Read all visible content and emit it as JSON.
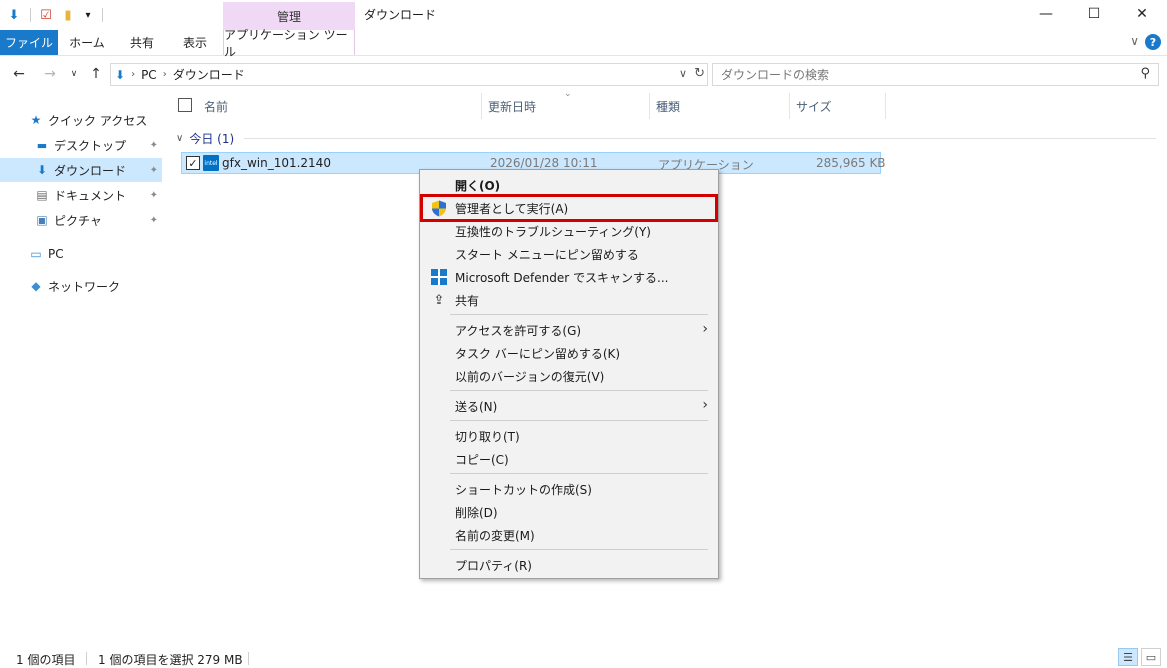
{
  "window": {
    "title": "ダウンロード",
    "manage_tab": "管理",
    "minimize": "—",
    "maximize": "☐",
    "close": "✕"
  },
  "ribbon": {
    "tabs": [
      {
        "label": "ファイル"
      },
      {
        "label": "ホーム"
      },
      {
        "label": "共有"
      },
      {
        "label": "表示"
      },
      {
        "label": "アプリケーション ツール"
      }
    ],
    "expand_glyph": "∨",
    "help_glyph": "?"
  },
  "address": {
    "crumbs": [
      "PC",
      "ダウンロード"
    ],
    "sep": "›",
    "search_placeholder": "ダウンロードの検索"
  },
  "sidebar": {
    "items": [
      {
        "label": "クイック アクセス",
        "icon": "star-icon"
      },
      {
        "label": "デスクトップ",
        "icon": "desktop-icon"
      },
      {
        "label": "ダウンロード",
        "icon": "download-icon"
      },
      {
        "label": "ドキュメント",
        "icon": "document-icon"
      },
      {
        "label": "ピクチャ",
        "icon": "picture-icon"
      },
      {
        "label": "PC",
        "icon": "pc-icon"
      },
      {
        "label": "ネットワーク",
        "icon": "network-icon"
      }
    ]
  },
  "columns": {
    "name": "名前",
    "date": "更新日時",
    "type": "種類",
    "size": "サイズ"
  },
  "group": {
    "label": "今日 (1)"
  },
  "file": {
    "name": "gfx_win_101.2140",
    "date": "2026/01/28 10:11",
    "type": "アプリケーション",
    "size": "285,965 KB",
    "icon_text": "intel"
  },
  "context_menu": {
    "open": "開く(O)",
    "run_as_admin": "管理者として実行(A)",
    "troubleshoot": "互換性のトラブルシューティング(Y)",
    "pin_start": "スタート メニューにピン留めする",
    "defender": "Microsoft Defender でスキャンする...",
    "share": "共有",
    "give_access": "アクセスを許可する(G)",
    "pin_taskbar": "タスク バーにピン留めする(K)",
    "restore_versions": "以前のバージョンの復元(V)",
    "send_to": "送る(N)",
    "cut": "切り取り(T)",
    "copy": "コピー(C)",
    "create_shortcut": "ショートカットの作成(S)",
    "delete": "削除(D)",
    "rename": "名前の変更(M)",
    "properties": "プロパティ(R)"
  },
  "status": {
    "count": "1 個の項目",
    "selected": "1 個の項目を選択  279 MB"
  },
  "colors": {
    "accent": "#1979ca",
    "selection": "#cce8ff",
    "manage_tab": "#f0d9f5",
    "highlight_box": "#d40000"
  }
}
